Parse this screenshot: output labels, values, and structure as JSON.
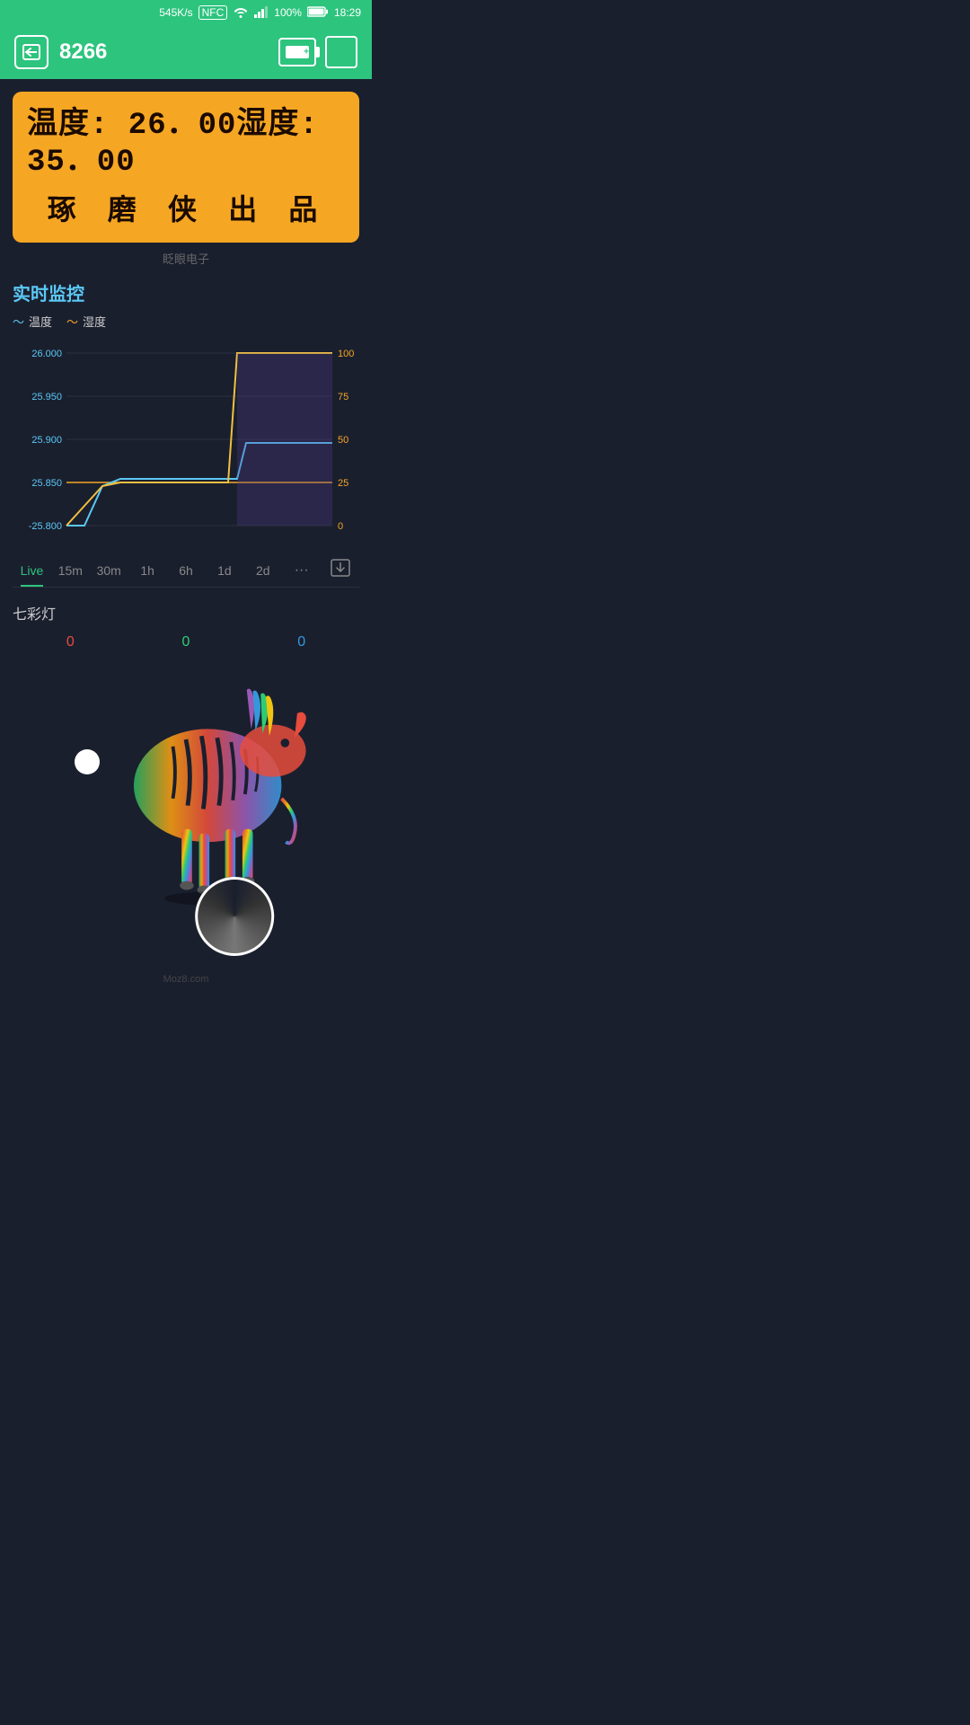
{
  "statusBar": {
    "speed": "545K/s",
    "nfc": "NFC",
    "signal": "WiFi",
    "battery": "100%",
    "time": "18:29"
  },
  "topBar": {
    "title": "8266",
    "backLabel": "←"
  },
  "displayPanel": {
    "line1": "温度: 26．00湿度: 35．00",
    "line2": "琢 磨 侠 出 品",
    "brand": "眨眼电子"
  },
  "chart": {
    "title": "实时监控",
    "legend": {
      "temp": "温度",
      "humi": "湿度"
    },
    "yAxisLeft": [
      "26.000",
      "25.950",
      "25.900",
      "25.850",
      "-25.800"
    ],
    "yAxisRight": [
      "100",
      "75",
      "50",
      "25",
      "0"
    ],
    "timeTabs": [
      "Live",
      "15m",
      "30m",
      "1h",
      "6h",
      "1d",
      "2d"
    ]
  },
  "colorLight": {
    "title": "七彩灯",
    "r": "0",
    "g": "0",
    "b": "0"
  },
  "footer": {
    "brand": "Moz8.com"
  }
}
